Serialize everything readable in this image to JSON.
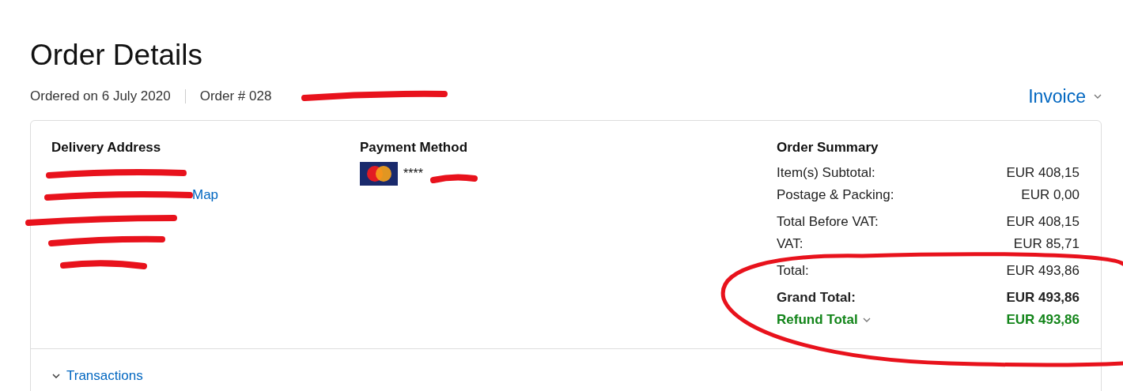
{
  "title": "Order Details",
  "meta": {
    "ordered_on": "Ordered on 6 July 2020",
    "order_number": "Order # 028"
  },
  "invoice": {
    "label": "Invoice"
  },
  "delivery": {
    "heading": "Delivery Address",
    "map_link": "Map"
  },
  "payment": {
    "heading": "Payment Method",
    "card_digits": "****"
  },
  "summary": {
    "heading": "Order Summary",
    "groups": [
      [
        {
          "label": "Item(s) Subtotal:",
          "value": "EUR 408,15",
          "kind": "normal"
        },
        {
          "label": "Postage & Packing:",
          "value": "EUR 0,00",
          "kind": "normal"
        }
      ],
      [
        {
          "label": "Total Before VAT:",
          "value": "EUR 408,15",
          "kind": "normal"
        },
        {
          "label": "VAT:",
          "value": "EUR 85,71",
          "kind": "normal"
        }
      ],
      [
        {
          "label": "Total:",
          "value": "EUR 493,86",
          "kind": "normal"
        }
      ],
      [
        {
          "label": "Grand Total:",
          "value": "EUR 493,86",
          "kind": "bold"
        },
        {
          "label": "Refund Total",
          "value": "EUR 493,86",
          "kind": "refund"
        }
      ]
    ]
  },
  "transactions": {
    "label": "Transactions"
  }
}
